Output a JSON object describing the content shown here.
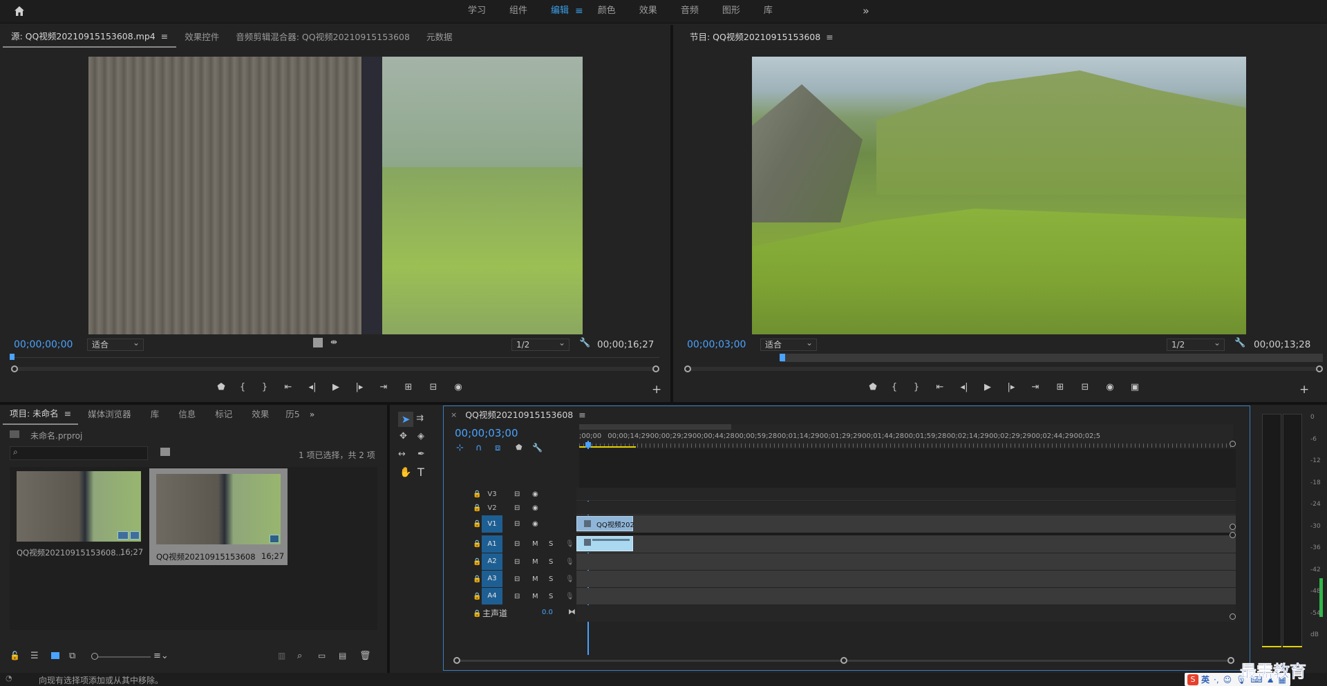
{
  "topbar": {
    "home_icon": "home-icon",
    "workspaces": [
      "学习",
      "组件",
      "编辑",
      "颜色",
      "效果",
      "音频",
      "图形",
      "库"
    ],
    "active_index": 2,
    "more_icon": "»"
  },
  "source_monitor": {
    "tabs": [
      "源: QQ视频20210915153608.mp4",
      "效果控件",
      "音频剪辑混合器: QQ视频20210915153608",
      "元数据"
    ],
    "timecode": "00;00;00;00",
    "fit": "适合",
    "resolution": "1/2",
    "duration": "00;00;16;27"
  },
  "program_monitor": {
    "tab": "节目: QQ视频20210915153608",
    "timecode": "00;00;03;00",
    "fit": "适合",
    "resolution": "1/2",
    "duration": "00;00;13;28"
  },
  "project_panel": {
    "tabs": [
      "项目: 未命名",
      "媒体浏览器",
      "库",
      "信息",
      "标记",
      "效果",
      "历5"
    ],
    "file": "未命名.prproj",
    "search_placeholder": "",
    "selection_info": "1 项已选择，共 2 项",
    "items": [
      {
        "name": "QQ视频20210915153608...",
        "duration": "16;27"
      },
      {
        "name": "QQ视频20210915153608",
        "duration": "16;27"
      }
    ]
  },
  "timeline": {
    "tab": "QQ视频20210915153608",
    "timecode": "00;00;03;00",
    "ruler_labels": [
      ";00;00",
      "00;00;14;29",
      "00;00;29;29",
      "00;00;44;28",
      "00;00;59;28",
      "00;01;14;29",
      "00;01;29;29",
      "00;01;44;28",
      "00;01;59;28",
      "00;02;14;29",
      "00;02;29;29",
      "00;02;44;29",
      "00;02;5"
    ],
    "video_tracks": [
      "V3",
      "V2",
      "V1"
    ],
    "audio_tracks": [
      "A1",
      "A2",
      "A3",
      "A4"
    ],
    "mute_label": "M",
    "solo_label": "S",
    "master_label": "主声道",
    "master_value": "0.0",
    "clip_label": "QQ视频202"
  },
  "audio_meter": {
    "ticks": [
      "0",
      "-6",
      "-12",
      "-18",
      "-24",
      "-30",
      "-36",
      "-42",
      "-48",
      "-54",
      "dB"
    ]
  },
  "status_bar": {
    "message": "向现有选择项添加或从其中移除。",
    "ime_text": "英",
    "watermark": "最需教育"
  },
  "colors": {
    "accent": "#3a9fe8",
    "timecode": "#4aa3ff",
    "track_on": "#1e5f93",
    "clip_video": "#8fb6d8",
    "clip_audio": "#a9d8f0"
  }
}
